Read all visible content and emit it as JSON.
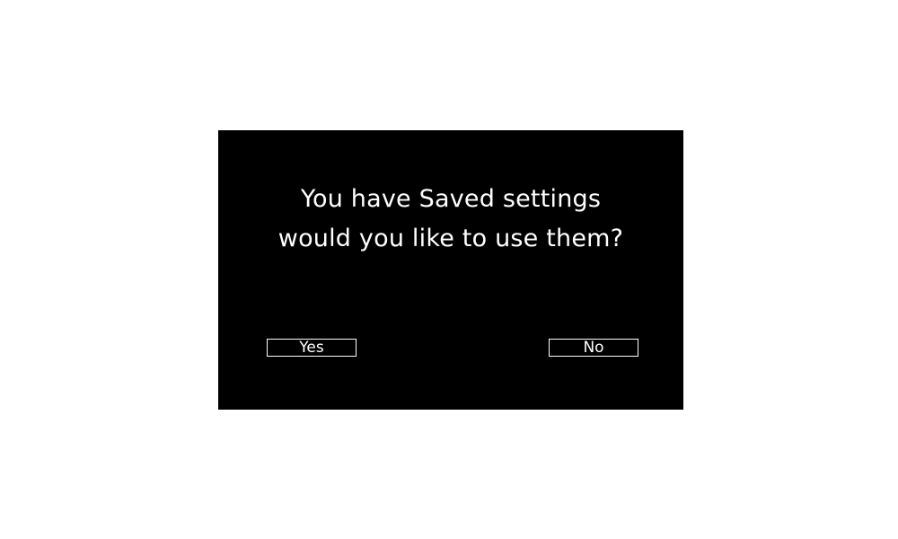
{
  "dialog": {
    "message_line_1": "You have Saved settings",
    "message_line_2": "would you like to use them?",
    "yes_label": "Yes",
    "no_label": "No"
  },
  "colors": {
    "page_background": "#ffffff",
    "dialog_background": "#000000",
    "text": "#ffffff"
  }
}
